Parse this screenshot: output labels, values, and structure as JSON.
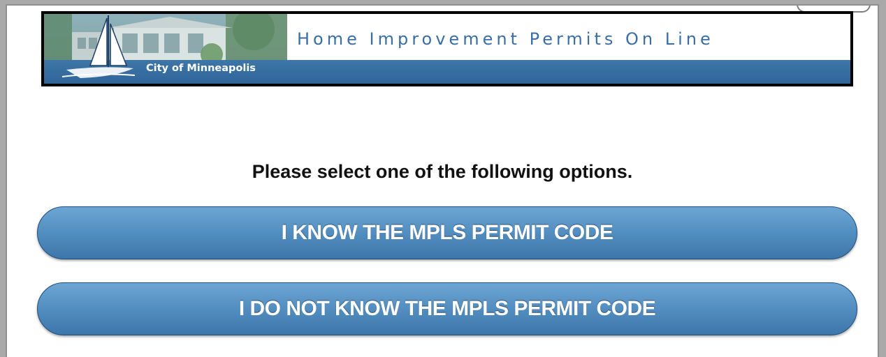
{
  "banner": {
    "title": "Home Improvement Permits On Line",
    "city": "City of Minneapolis",
    "stripe_color": "#2f6598",
    "title_color": "#3a6ea6"
  },
  "main": {
    "prompt": "Please select one of the following options.",
    "options": [
      {
        "label": "I KNOW THE MPLS PERMIT CODE"
      },
      {
        "label": "I DO NOT KNOW THE MPLS PERMIT CODE"
      }
    ],
    "button_color": "#4a86bb"
  },
  "icons": {
    "logo": "sailboat-logo-icon",
    "banner_photo": "house-photo"
  }
}
